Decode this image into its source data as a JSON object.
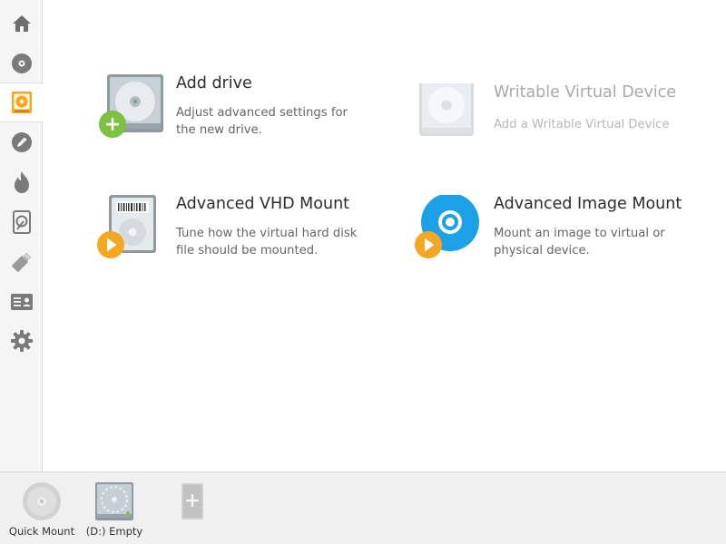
{
  "sidebar": {
    "items": [
      {
        "icon": "home-icon"
      },
      {
        "icon": "disc-icon"
      },
      {
        "icon": "hard-drive-icon",
        "active": true
      },
      {
        "icon": "pencil-icon"
      },
      {
        "icon": "flame-icon"
      },
      {
        "icon": "vhd-icon"
      },
      {
        "icon": "usb-icon"
      },
      {
        "icon": "id-card-icon"
      },
      {
        "icon": "gear-icon"
      }
    ]
  },
  "main": {
    "cards": [
      {
        "title": "Add drive",
        "desc": "Adjust advanced settings for the new drive.",
        "icon": "hdd-add-icon"
      },
      {
        "title": "Writable Virtual Device",
        "desc": "Add a Writable Virtual Device",
        "icon": "writable-device-icon",
        "disabled": true
      },
      {
        "title": "Advanced VHD Mount",
        "desc": "Tune how the virtual hard disk file should be mounted.",
        "icon": "vhd-mount-icon"
      },
      {
        "title": "Advanced Image Mount",
        "desc": "Mount an image to virtual or physical device.",
        "icon": "image-mount-icon"
      }
    ]
  },
  "bottom_bar": {
    "devices": [
      {
        "label": "Quick Mount",
        "icon": "disc-icon"
      },
      {
        "label": "(D:) Empty",
        "icon": "virtual-drive-icon"
      },
      {
        "label": "",
        "icon": "add-device-icon"
      }
    ]
  },
  "colors": {
    "accent_orange": "#f5a623",
    "accent_green": "#7cc142",
    "accent_blue": "#1da1e6",
    "sidebar_bg": "#f5f5f5",
    "bottom_bg": "#f0f0f0"
  }
}
